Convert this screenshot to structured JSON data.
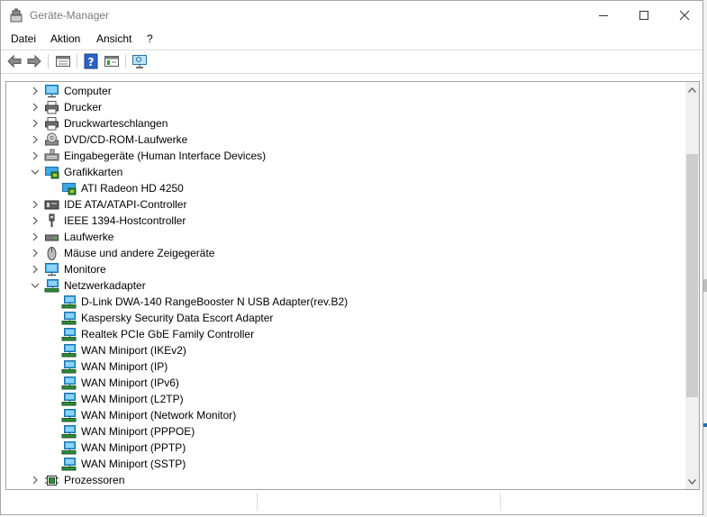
{
  "window": {
    "title": "Geräte-Manager"
  },
  "menu": [
    "Datei",
    "Aktion",
    "Ansicht",
    "?"
  ],
  "toolbar": [
    {
      "name": "back-icon",
      "icon": "arrow-left"
    },
    {
      "name": "forward-icon",
      "icon": "arrow-right"
    },
    {
      "name": "properties-icon",
      "icon": "properties-sheet"
    },
    {
      "name": "help-icon",
      "icon": "help-question"
    },
    {
      "name": "view-icon",
      "icon": "console-view"
    },
    {
      "name": "scan-hardware-icon",
      "icon": "monitor-scan"
    }
  ],
  "tree": [
    {
      "label": "Computer",
      "level": 0,
      "state": "collapsed",
      "icon": "computer"
    },
    {
      "label": "Drucker",
      "level": 0,
      "state": "collapsed",
      "icon": "printer"
    },
    {
      "label": "Druckwarteschlangen",
      "level": 0,
      "state": "collapsed",
      "icon": "printer"
    },
    {
      "label": "DVD/CD-ROM-Laufwerke",
      "level": 0,
      "state": "collapsed",
      "icon": "disc"
    },
    {
      "label": "Eingabegeräte (Human Interface Devices)",
      "level": 0,
      "state": "collapsed",
      "icon": "keyboard"
    },
    {
      "label": "Grafikkarten",
      "level": 0,
      "state": "expanded",
      "icon": "display-adapter"
    },
    {
      "label": "ATI Radeon HD 4250",
      "level": 1,
      "state": "leaf",
      "icon": "display-adapter"
    },
    {
      "label": "IDE ATA/ATAPI-Controller",
      "level": 0,
      "state": "collapsed",
      "icon": "ide-controller"
    },
    {
      "label": "IEEE 1394-Hostcontroller",
      "level": 0,
      "state": "collapsed",
      "icon": "firewire"
    },
    {
      "label": "Laufwerke",
      "level": 0,
      "state": "collapsed",
      "icon": "drive"
    },
    {
      "label": "Mäuse und andere Zeigegeräte",
      "level": 0,
      "state": "collapsed",
      "icon": "mouse"
    },
    {
      "label": "Monitore",
      "level": 0,
      "state": "collapsed",
      "icon": "monitor"
    },
    {
      "label": "Netzwerkadapter",
      "level": 0,
      "state": "expanded",
      "icon": "network"
    },
    {
      "label": "D-Link DWA-140 RangeBooster N USB Adapter(rev.B2)",
      "level": 1,
      "state": "leaf",
      "icon": "network"
    },
    {
      "label": "Kaspersky Security Data Escort Adapter",
      "level": 1,
      "state": "leaf",
      "icon": "network"
    },
    {
      "label": "Realtek PCIe GbE Family Controller",
      "level": 1,
      "state": "leaf",
      "icon": "network"
    },
    {
      "label": "WAN Miniport (IKEv2)",
      "level": 1,
      "state": "leaf",
      "icon": "network"
    },
    {
      "label": "WAN Miniport (IP)",
      "level": 1,
      "state": "leaf",
      "icon": "network"
    },
    {
      "label": "WAN Miniport (IPv6)",
      "level": 1,
      "state": "leaf",
      "icon": "network"
    },
    {
      "label": "WAN Miniport (L2TP)",
      "level": 1,
      "state": "leaf",
      "icon": "network"
    },
    {
      "label": "WAN Miniport (Network Monitor)",
      "level": 1,
      "state": "leaf",
      "icon": "network"
    },
    {
      "label": "WAN Miniport (PPPOE)",
      "level": 1,
      "state": "leaf",
      "icon": "network"
    },
    {
      "label": "WAN Miniport (PPTP)",
      "level": 1,
      "state": "leaf",
      "icon": "network"
    },
    {
      "label": "WAN Miniport (SSTP)",
      "level": 1,
      "state": "leaf",
      "icon": "network"
    },
    {
      "label": "Prozessoren",
      "level": 0,
      "state": "collapsed",
      "icon": "processor"
    }
  ],
  "colors": {
    "selection_hover": "#cce8ff",
    "accent": "#1e90d8",
    "title_text": "#7a7a7a"
  }
}
